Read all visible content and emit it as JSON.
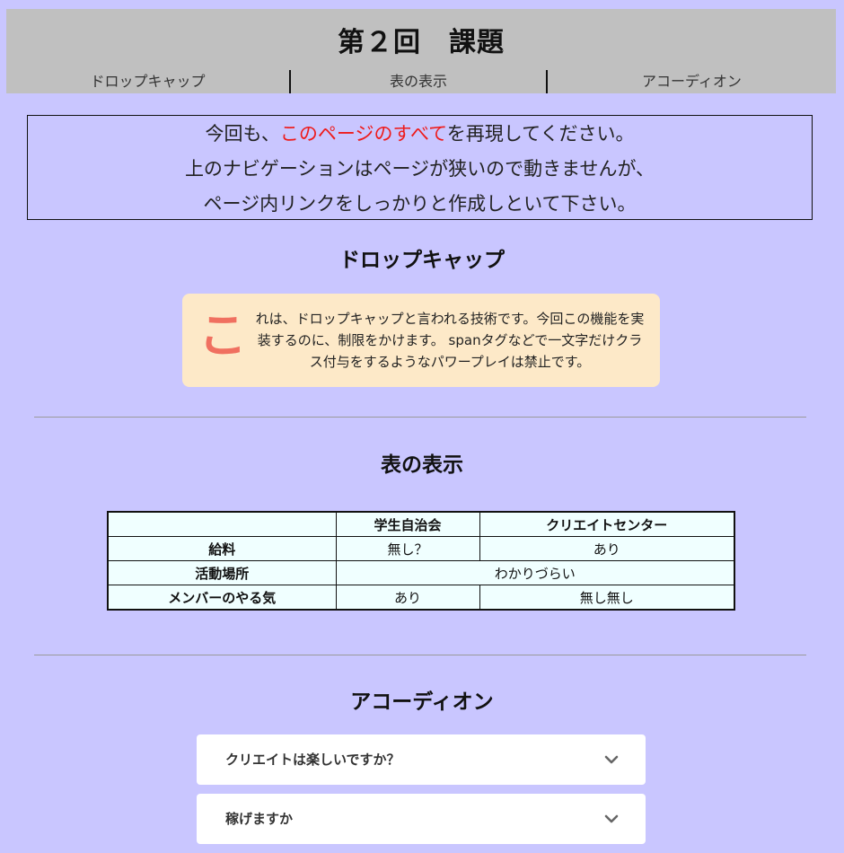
{
  "header": {
    "title": "第２回　課題",
    "nav": [
      "ドロップキャップ",
      "表の表示",
      "アコーディオン"
    ]
  },
  "intro": {
    "line1_before": "今回も、",
    "line1_highlight": "このページのすべて",
    "line1_after": "を再現してください。",
    "line2": "上のナビゲーションはページが狭いので動きませんが、",
    "line3": "ページ内リンクをしっかりと作成しといて下さい。"
  },
  "dropcap": {
    "heading": "ドロップキャップ",
    "letter": "こ",
    "text": "れは、ドロップキャップと言われる技術です。今回この機能を実装するのに、制限をかけます。 spanタグなどで一文字だけクラス付与をするようなパワープレイは禁止です。"
  },
  "table_section": {
    "heading": "表の表示",
    "header": [
      "",
      "学生自治会",
      "クリエイトセンター"
    ],
    "rows": [
      {
        "label": "給料",
        "cells": [
          "無し？",
          "あり"
        ]
      },
      {
        "label": "活動場所",
        "merged": "わかりづらい"
      },
      {
        "label": "メンバーのやる気",
        "cells": [
          "あり",
          "無し無し"
        ]
      }
    ]
  },
  "accordion": {
    "heading": "アコーディオン",
    "items": [
      {
        "question": "クリエイトは楽しいですか？",
        "icon": "chevron-down-icon"
      },
      {
        "question": "稼げますか",
        "icon": "chevron-down-icon"
      }
    ]
  },
  "colors": {
    "background": "#c9c6ff",
    "header": "#c0c0c0",
    "highlight": "#ee1b1b",
    "dropcap_box": "#fde9c8",
    "dropcap_letter": "#f07060",
    "table_bg": "#f0ffff"
  }
}
